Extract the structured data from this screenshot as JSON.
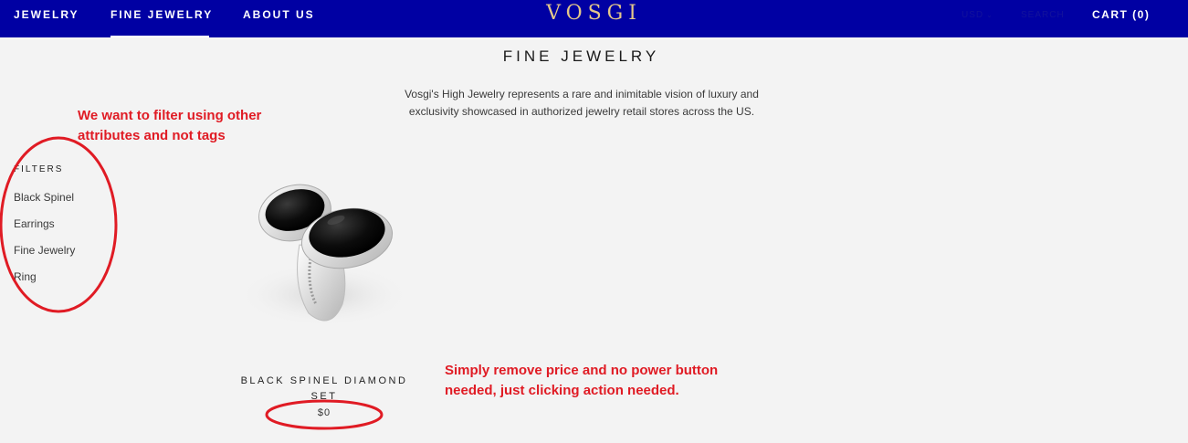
{
  "header": {
    "nav": [
      {
        "label": "JEWELRY"
      },
      {
        "label": "FINE JEWELRY"
      },
      {
        "label": "ABOUT US"
      }
    ],
    "logo": "VOSGI",
    "currency": "USD",
    "search_label": "SEARCH",
    "cart_label": "CART (0)"
  },
  "page": {
    "title": "FINE JEWELRY",
    "description": "Vosgi's High Jewelry represents a rare and inimitable vision of luxury and exclusivity showcased in authorized jewelry retail stores across the US."
  },
  "filters": {
    "heading": "FILTERS",
    "items": [
      "Black Spinel",
      "Earrings",
      "Fine Jewelry",
      "Ring"
    ]
  },
  "products": [
    {
      "name": "BLACK SPINEL DIAMOND SET",
      "price": "$0"
    }
  ],
  "annotations": {
    "filters_note": "We want to filter using other\nattributes and not tags",
    "price_note": "Simply remove price and no power button\nneeded, just clicking action needed.",
    "color": "#e01b24"
  },
  "colors": {
    "header_bg": "#0000a3",
    "logo": "#e4c78a",
    "page_bg": "#f3f3f3"
  },
  "icons": [
    "chevron-down-icon"
  ]
}
